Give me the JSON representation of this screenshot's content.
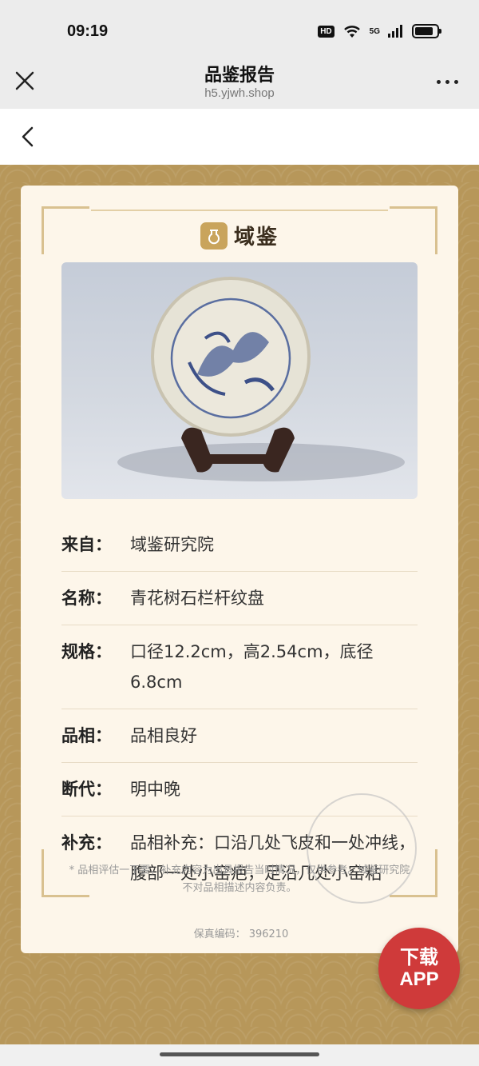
{
  "status_bar": {
    "time": "09:19",
    "hd": "HD",
    "network": "5G",
    "icons": [
      "wifi-icon",
      "signal-icon",
      "battery-icon"
    ],
    "battery_level": 0.85
  },
  "nav": {
    "title": "品鉴报告",
    "url": "h5.yjwh.shop",
    "close_icon": "close-icon",
    "more_icon": "more-icon"
  },
  "back": {
    "icon": "chevron-left-icon"
  },
  "card": {
    "brand_name": "域鉴",
    "details": [
      {
        "label": "来自：",
        "value": "域鉴研究院"
      },
      {
        "label": "名称：",
        "value": "青花树石栏杆纹盘"
      },
      {
        "label": "规格：",
        "value": "口径12.2cm，高2.54cm，底径6.8cm"
      },
      {
        "label": "品相：",
        "value": "品相良好"
      },
      {
        "label": "断代：",
        "value": "明中晚"
      },
      {
        "label": "补充：",
        "value": "品相补充：口沿几处飞皮和一处冲线，腹部一处小窑疤，足沿几处小窑粘"
      }
    ],
    "disclaimer": "* 品相评估一下要，补充内容为出具报告当时情况，仅供参考。域鉴研究院不对品相描述内容负责。",
    "code_label": "保真编码：",
    "code_value": "396210"
  },
  "app_button": {
    "line1": "下载",
    "line2": "APP"
  },
  "colors": {
    "background": "#b89a5f",
    "card": "#fdf6ea",
    "brand": "#c9a45c",
    "app_button": "#cf3a3a"
  }
}
